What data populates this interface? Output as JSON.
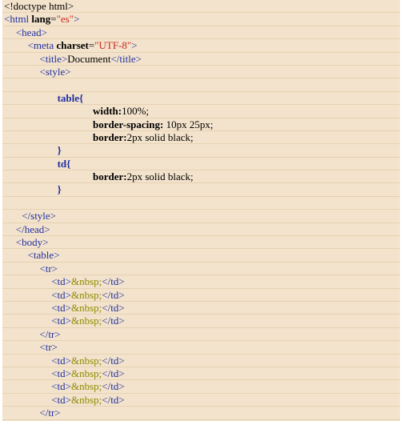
{
  "colors": {
    "panel_background": "#f3e3cc",
    "line_separator": "#e6d2b2",
    "default": "#000000",
    "tag": "#1f2fa0",
    "attr": "#000000",
    "value": "#c8281e",
    "entity": "#8c8a00",
    "selector": "#1f2fa0",
    "prop": "#000000"
  },
  "code_lines": [
    {
      "indent": 0,
      "segments": [
        {
          "t": "<!doctype html>",
          "c": "default"
        }
      ]
    },
    {
      "indent": 0,
      "segments": [
        {
          "t": "<html ",
          "c": "tag"
        },
        {
          "t": "lang",
          "c": "attr"
        },
        {
          "t": "=",
          "c": "eq"
        },
        {
          "t": "\"es\"",
          "c": "value"
        },
        {
          "t": ">",
          "c": "tag"
        }
      ]
    },
    {
      "indent": 2,
      "segments": [
        {
          "t": "<head>",
          "c": "tag"
        }
      ]
    },
    {
      "indent": 4,
      "segments": [
        {
          "t": "<meta ",
          "c": "tag"
        },
        {
          "t": "charset",
          "c": "attr"
        },
        {
          "t": "=",
          "c": "eq"
        },
        {
          "t": "\"UTF-8\"",
          "c": "value"
        },
        {
          "t": ">",
          "c": "tag"
        }
      ]
    },
    {
      "indent": 6,
      "segments": [
        {
          "t": "<title>",
          "c": "tag"
        },
        {
          "t": "Document",
          "c": "default"
        },
        {
          "t": "</title>",
          "c": "tag"
        }
      ]
    },
    {
      "indent": 6,
      "segments": [
        {
          "t": "<style>",
          "c": "tag"
        }
      ]
    },
    {
      "indent": 0,
      "segments": []
    },
    {
      "indent": 9,
      "segments": [
        {
          "t": "table{",
          "c": "selector"
        }
      ]
    },
    {
      "indent": 15,
      "segments": [
        {
          "t": "width:",
          "c": "prop"
        },
        {
          "t": "100%;",
          "c": "cssval"
        }
      ]
    },
    {
      "indent": 15,
      "segments": [
        {
          "t": "border-spacing:",
          "c": "prop"
        },
        {
          "t": " 10px 25px;",
          "c": "cssval"
        }
      ]
    },
    {
      "indent": 15,
      "segments": [
        {
          "t": "border:",
          "c": "prop"
        },
        {
          "t": "2px solid black;",
          "c": "cssval"
        }
      ]
    },
    {
      "indent": 9,
      "segments": [
        {
          "t": "}",
          "c": "brace"
        }
      ]
    },
    {
      "indent": 9,
      "segments": [
        {
          "t": "td{",
          "c": "selector"
        }
      ]
    },
    {
      "indent": 15,
      "segments": [
        {
          "t": "border:",
          "c": "prop"
        },
        {
          "t": "2px solid black;",
          "c": "cssval"
        }
      ]
    },
    {
      "indent": 9,
      "segments": [
        {
          "t": "}",
          "c": "brace"
        }
      ]
    },
    {
      "indent": 0,
      "segments": []
    },
    {
      "indent": 3,
      "segments": [
        {
          "t": "</style>",
          "c": "tag"
        }
      ]
    },
    {
      "indent": 2,
      "segments": [
        {
          "t": "</head>",
          "c": "tag"
        }
      ]
    },
    {
      "indent": 2,
      "segments": [
        {
          "t": "<body>",
          "c": "tag"
        }
      ]
    },
    {
      "indent": 4,
      "segments": [
        {
          "t": "<table>",
          "c": "tag"
        }
      ]
    },
    {
      "indent": 6,
      "segments": [
        {
          "t": "<tr>",
          "c": "tag"
        }
      ]
    },
    {
      "indent": 8,
      "segments": [
        {
          "t": "<td>",
          "c": "tag"
        },
        {
          "t": "&nbsp;",
          "c": "entity"
        },
        {
          "t": "</td>",
          "c": "tag"
        }
      ]
    },
    {
      "indent": 8,
      "segments": [
        {
          "t": "<td>",
          "c": "tag"
        },
        {
          "t": "&nbsp;",
          "c": "entity"
        },
        {
          "t": "</td>",
          "c": "tag"
        }
      ]
    },
    {
      "indent": 8,
      "segments": [
        {
          "t": "<td>",
          "c": "tag"
        },
        {
          "t": "&nbsp;",
          "c": "entity"
        },
        {
          "t": "</td>",
          "c": "tag"
        }
      ]
    },
    {
      "indent": 8,
      "segments": [
        {
          "t": "<td>",
          "c": "tag"
        },
        {
          "t": "&nbsp;",
          "c": "entity"
        },
        {
          "t": "</td>",
          "c": "tag"
        }
      ]
    },
    {
      "indent": 6,
      "segments": [
        {
          "t": "</tr>",
          "c": "tag"
        }
      ]
    },
    {
      "indent": 6,
      "segments": [
        {
          "t": "<tr>",
          "c": "tag"
        }
      ]
    },
    {
      "indent": 8,
      "segments": [
        {
          "t": "<td>",
          "c": "tag"
        },
        {
          "t": "&nbsp;",
          "c": "entity"
        },
        {
          "t": "</td>",
          "c": "tag"
        }
      ]
    },
    {
      "indent": 8,
      "segments": [
        {
          "t": "<td>",
          "c": "tag"
        },
        {
          "t": "&nbsp;",
          "c": "entity"
        },
        {
          "t": "</td>",
          "c": "tag"
        }
      ]
    },
    {
      "indent": 8,
      "segments": [
        {
          "t": "<td>",
          "c": "tag"
        },
        {
          "t": "&nbsp;",
          "c": "entity"
        },
        {
          "t": "</td>",
          "c": "tag"
        }
      ]
    },
    {
      "indent": 8,
      "segments": [
        {
          "t": "<td>",
          "c": "tag"
        },
        {
          "t": "&nbsp;",
          "c": "entity"
        },
        {
          "t": "</td>",
          "c": "tag"
        }
      ]
    },
    {
      "indent": 6,
      "segments": [
        {
          "t": "</tr>",
          "c": "tag"
        }
      ]
    }
  ]
}
